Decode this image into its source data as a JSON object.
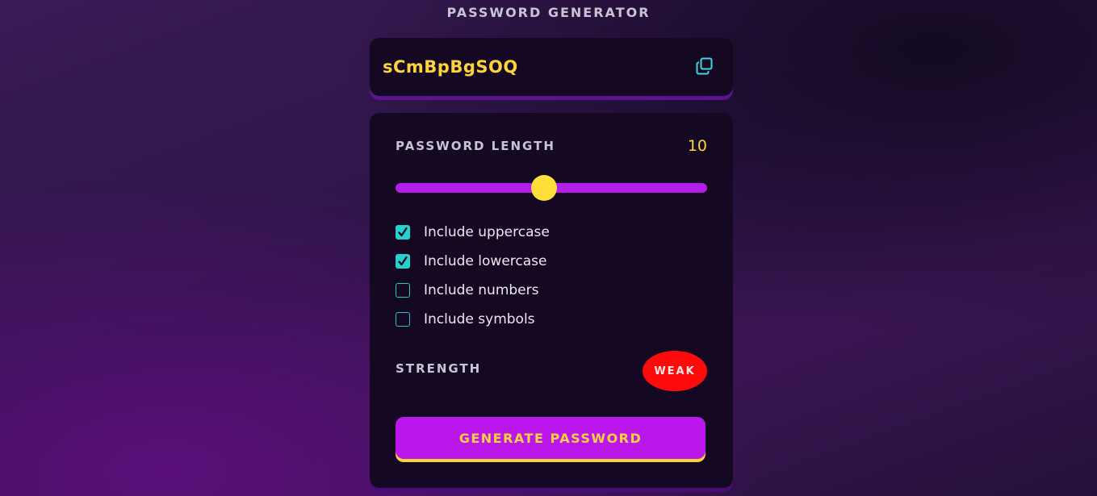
{
  "app": {
    "title": "PASSWORD GENERATOR"
  },
  "password": {
    "value": "sCmBpBgSOQ",
    "copy_icon": "copy-icon"
  },
  "length": {
    "label": "PASSWORD LENGTH",
    "value": "10",
    "fraction": 0.477
  },
  "options": [
    {
      "label": "Include uppercase",
      "checked": true
    },
    {
      "label": "Include lowercase",
      "checked": true
    },
    {
      "label": "Include numbers",
      "checked": false
    },
    {
      "label": "Include symbols",
      "checked": false
    }
  ],
  "strength": {
    "label": "STRENGTH",
    "badge": "WEAK",
    "color": "#ff0a0a"
  },
  "generate_button": {
    "label": "GENERATE PASSWORD"
  },
  "colors": {
    "accent": "#bb16ec",
    "highlight": "#ffd43b",
    "checkbox": "#27d0cf",
    "panel": "#150822"
  }
}
